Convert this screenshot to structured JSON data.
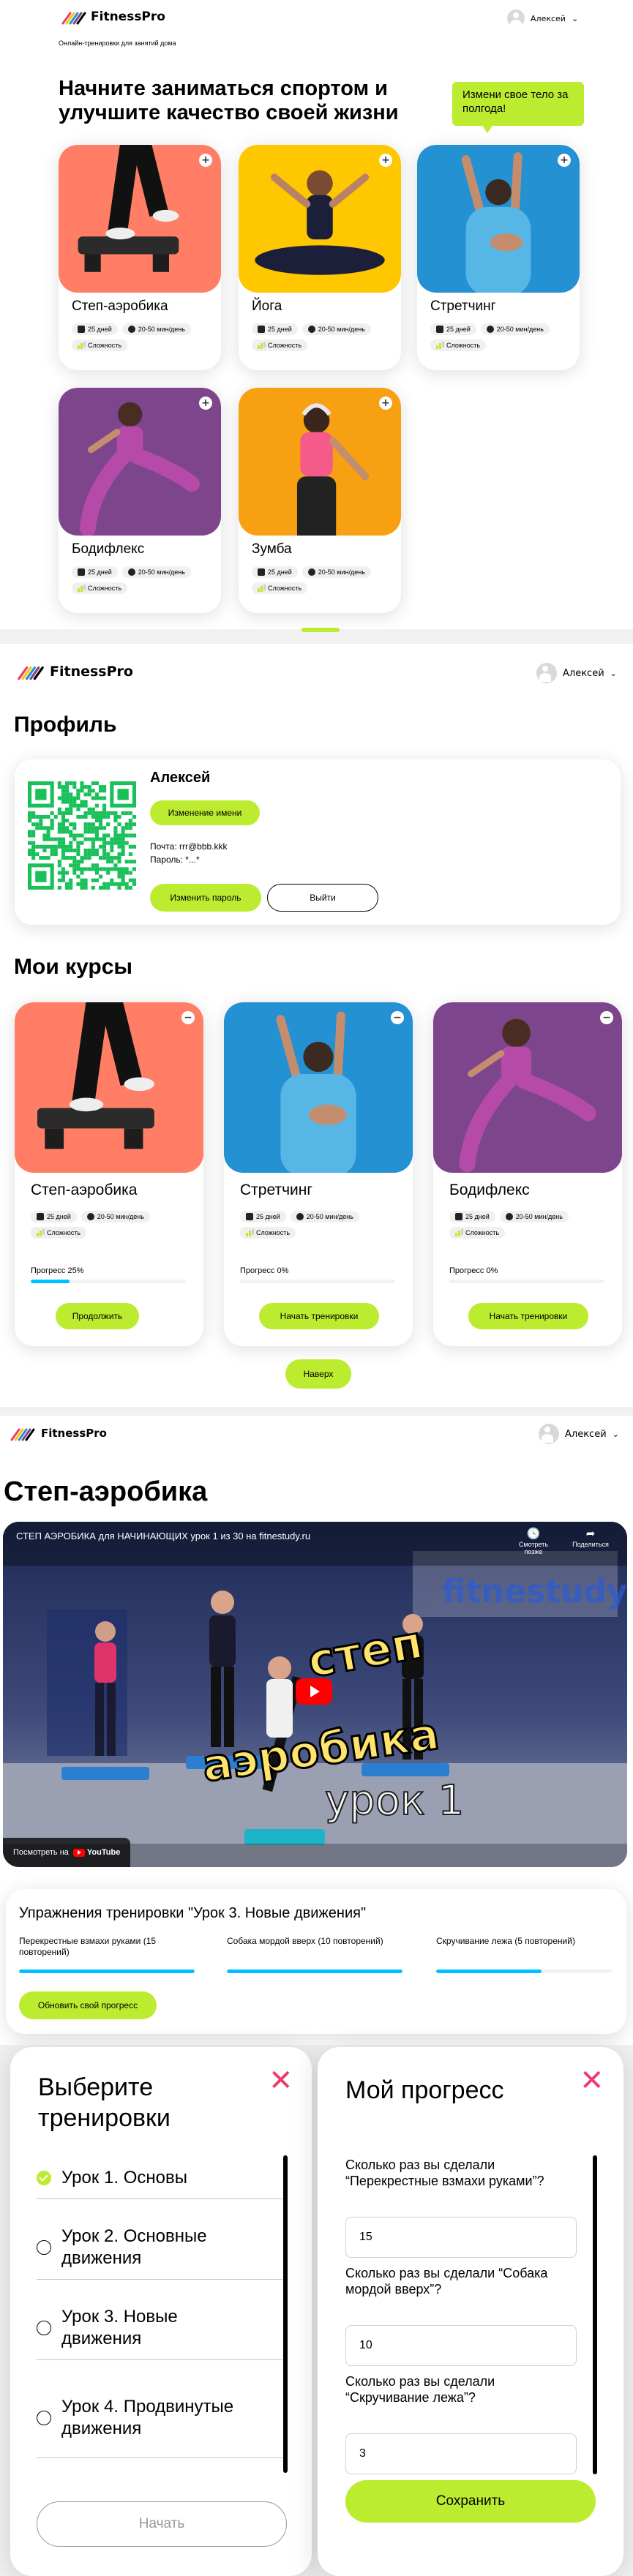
{
  "brand": {
    "name": "FitnessPro",
    "tagline": "Онлайн-тренировки для занятий дома",
    "accent": "#bcec30",
    "progress_color": "#00c1ff",
    "close_color": "#ef3a6e"
  },
  "user": {
    "name": "Алексей"
  },
  "main": {
    "headline": "Начните заниматься спортом и улучшите качество своей жизни",
    "bubble": "Измени свое тело за полгода!",
    "courses": [
      {
        "title": "Степ-аэробика",
        "days": "25 дней",
        "duration": "20-50 мин/день",
        "level": "Сложность",
        "bg": "#ff7e65"
      },
      {
        "title": "Йога",
        "days": "25 дней",
        "duration": "20-50 мин/день",
        "level": "Сложность",
        "bg": "#ffc700"
      },
      {
        "title": "Стретчинг",
        "days": "25 дней",
        "duration": "20-50 мин/день",
        "level": "Сложность",
        "bg": "#2491d2"
      },
      {
        "title": "Бодифлекс",
        "days": "25 дней",
        "duration": "20-50 мин/день",
        "level": "Сложность",
        "bg": "#7d458c"
      },
      {
        "title": "Зумба",
        "days": "25 дней",
        "duration": "20-50 мин/день",
        "level": "Сложность",
        "bg": "#f7a012"
      }
    ]
  },
  "profile": {
    "title": "Профиль",
    "name": "Алексей",
    "change_name": "Изменение имени",
    "email": "Почта: rrr@bbb.kkk",
    "password": "Пароль: *...*",
    "change_password": "Изменить пароль",
    "logout": "Выйти",
    "my_courses": "Мои курсы",
    "up": "Наверх",
    "courses": [
      {
        "title": "Степ-аэробика",
        "days": "25 дней",
        "duration": "20-50 мин/день",
        "level": "Сложность",
        "progress_label": "Прогресс 25%",
        "progress": 0.25,
        "button": "Продолжить",
        "bg": "#ff7e65"
      },
      {
        "title": "Стретчинг",
        "days": "25 дней",
        "duration": "20-50 мин/день",
        "level": "Сложность",
        "progress_label": "Прогресс 0%",
        "progress": 0,
        "button": "Начать тренировки",
        "bg": "#2491d2"
      },
      {
        "title": "Бодифлекс",
        "days": "25 дней",
        "duration": "20-50 мин/день",
        "level": "Сложность",
        "progress_label": "Прогресс 0%",
        "progress": 0,
        "button": "Начать тренировки",
        "bg": "#7d458c"
      }
    ]
  },
  "workout": {
    "title": "Степ-аэробика",
    "video": {
      "title": "СТЕП АЭРОБИКА для НАЧИНАЮЩИХ урок 1 из 30 на fitnestudy.ru",
      "watch_later": "Смотреть позже",
      "share": "Поделиться",
      "watch_on": "Посмотреть на",
      "youtube": "YouTube",
      "overlay_line1": "степ",
      "overlay_line2": "аэробика",
      "overlay_line3": "урок 1",
      "site": "fitnestudy.ru"
    },
    "exercises_title": "Упражнения тренировки \"Урок 3. Новые движения\"",
    "exercises": [
      {
        "label": "Перекрестные взмахи руками (15 повторений)",
        "progress": 1.0
      },
      {
        "label": "Собака мордой вверх (10 повторений)",
        "progress": 1.0
      },
      {
        "label": "Скручивание лежа (5 повторений)",
        "progress": 0.6
      }
    ],
    "update_progress": "Обновить свой прогресс"
  },
  "select_modal": {
    "title": "Выберите тренировки",
    "lessons": [
      {
        "label": "Урок 1. Основы",
        "checked": true
      },
      {
        "label": "Урок 2. Основные движения",
        "checked": false
      },
      {
        "label": "Урок 3. Новые движения",
        "checked": false
      },
      {
        "label": "Урок 4. Продвинутые движения",
        "checked": false
      }
    ],
    "start": "Начать"
  },
  "progress_modal": {
    "title": "Мой прогресс",
    "questions": [
      {
        "label": "Сколько раз вы сделали “Перекрестные взмахи руками”?",
        "value": "15"
      },
      {
        "label": "Сколько раз вы сделали “Собака мордой вверх”?",
        "value": "10"
      },
      {
        "label": "Сколько раз вы сделали “Скручивание лежа”?",
        "value": "3"
      }
    ],
    "save": "Сохранить"
  }
}
